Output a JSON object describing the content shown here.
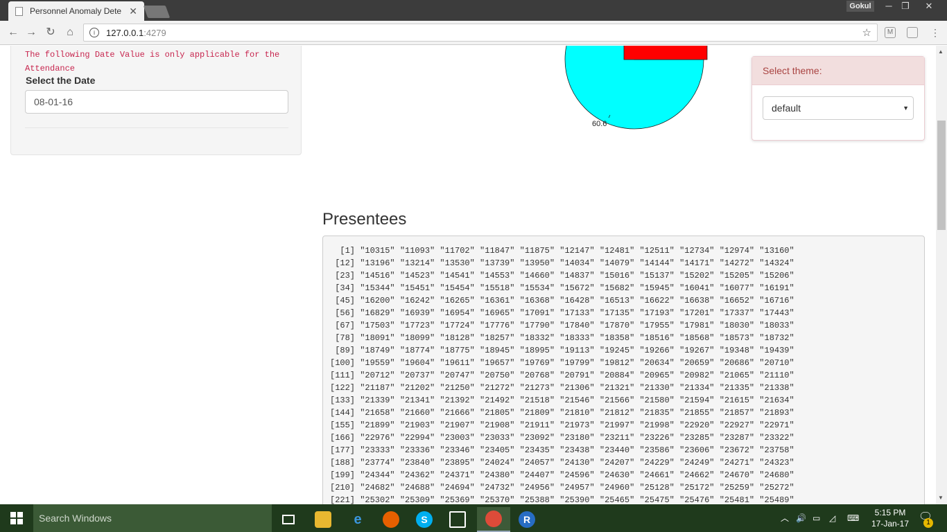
{
  "browser": {
    "tab_title": "Personnel Anomaly Dete",
    "tab_close": "✕",
    "user_name": "Gokul",
    "url_host": "127.0.0.1",
    "url_port": ":4279",
    "minimize": "─",
    "restore": "❐",
    "close": "✕"
  },
  "sidebar": {
    "note": "The following Date Value is only applicable for the Attendance",
    "date_label": "Select the Date",
    "date_value": "08-01-16"
  },
  "chart": {
    "slice_label": "60.6",
    "colors": {
      "main": "#00ffff",
      "secondary": "#ff0000"
    }
  },
  "theme_panel": {
    "heading": "Select theme:",
    "selected": "default"
  },
  "presentees": {
    "title": "Presentees",
    "rows": [
      "  [1] \"10315\" \"11093\" \"11702\" \"11847\" \"11875\" \"12147\" \"12481\" \"12511\" \"12734\" \"12974\" \"13160\"",
      " [12] \"13196\" \"13214\" \"13530\" \"13739\" \"13950\" \"14034\" \"14079\" \"14144\" \"14171\" \"14272\" \"14324\"",
      " [23] \"14516\" \"14523\" \"14541\" \"14553\" \"14660\" \"14837\" \"15016\" \"15137\" \"15202\" \"15205\" \"15206\"",
      " [34] \"15344\" \"15451\" \"15454\" \"15518\" \"15534\" \"15672\" \"15682\" \"15945\" \"16041\" \"16077\" \"16191\"",
      " [45] \"16200\" \"16242\" \"16265\" \"16361\" \"16368\" \"16428\" \"16513\" \"16622\" \"16638\" \"16652\" \"16716\"",
      " [56] \"16829\" \"16939\" \"16954\" \"16965\" \"17091\" \"17133\" \"17135\" \"17193\" \"17201\" \"17337\" \"17443\"",
      " [67] \"17503\" \"17723\" \"17724\" \"17776\" \"17790\" \"17840\" \"17870\" \"17955\" \"17981\" \"18030\" \"18033\"",
      " [78] \"18091\" \"18099\" \"18128\" \"18257\" \"18332\" \"18333\" \"18358\" \"18516\" \"18568\" \"18573\" \"18732\"",
      " [89] \"18749\" \"18774\" \"18775\" \"18945\" \"18995\" \"19113\" \"19245\" \"19266\" \"19267\" \"19348\" \"19439\"",
      "[100] \"19559\" \"19604\" \"19611\" \"19657\" \"19769\" \"19799\" \"19812\" \"20634\" \"20659\" \"20686\" \"20710\"",
      "[111] \"20712\" \"20737\" \"20747\" \"20750\" \"20768\" \"20791\" \"20884\" \"20965\" \"20982\" \"21065\" \"21110\"",
      "[122] \"21187\" \"21202\" \"21250\" \"21272\" \"21273\" \"21306\" \"21321\" \"21330\" \"21334\" \"21335\" \"21338\"",
      "[133] \"21339\" \"21341\" \"21392\" \"21492\" \"21518\" \"21546\" \"21566\" \"21580\" \"21594\" \"21615\" \"21634\"",
      "[144] \"21658\" \"21660\" \"21666\" \"21805\" \"21809\" \"21810\" \"21812\" \"21835\" \"21855\" \"21857\" \"21893\"",
      "[155] \"21899\" \"21903\" \"21907\" \"21908\" \"21911\" \"21973\" \"21997\" \"21998\" \"22920\" \"22927\" \"22971\"",
      "[166] \"22976\" \"22994\" \"23003\" \"23033\" \"23092\" \"23180\" \"23211\" \"23226\" \"23285\" \"23287\" \"23322\"",
      "[177] \"23333\" \"23336\" \"23346\" \"23405\" \"23435\" \"23438\" \"23440\" \"23586\" \"23606\" \"23672\" \"23758\"",
      "[188] \"23774\" \"23840\" \"23895\" \"24024\" \"24057\" \"24130\" \"24207\" \"24229\" \"24249\" \"24271\" \"24323\"",
      "[199] \"24344\" \"24362\" \"24371\" \"24380\" \"24407\" \"24596\" \"24630\" \"24661\" \"24662\" \"24670\" \"24680\"",
      "[210] \"24682\" \"24688\" \"24694\" \"24732\" \"24956\" \"24957\" \"24960\" \"25128\" \"25172\" \"25259\" \"25272\"",
      "[221] \"25302\" \"25309\" \"25369\" \"25370\" \"25388\" \"25390\" \"25465\" \"25475\" \"25476\" \"25481\" \"25489\""
    ]
  },
  "taskbar": {
    "search_placeholder": "Search Windows",
    "time": "5:15 PM",
    "date": "17-Jan-17",
    "notification_count": "1"
  }
}
